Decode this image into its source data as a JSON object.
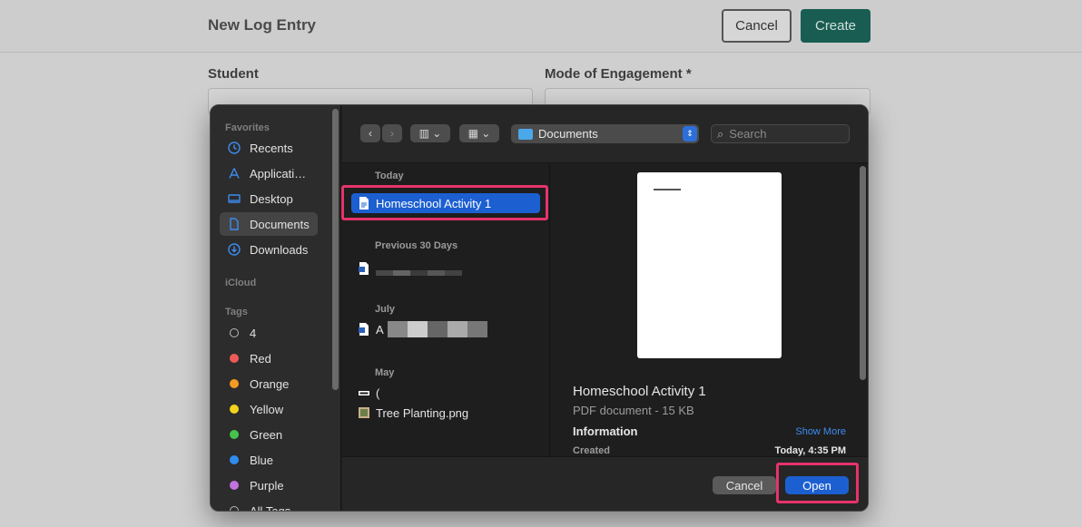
{
  "background_page": {
    "title": "New Log Entry",
    "cancel_label": "Cancel",
    "create_label": "Create",
    "student_label": "Student",
    "student_value": "",
    "mode_label": "Mode of Engagement *",
    "mode_value": ""
  },
  "sidebar": {
    "favorites_heading": "Favorites",
    "favorites": [
      {
        "label": "Recents",
        "icon": "clock-icon"
      },
      {
        "label": "Applicati…",
        "icon": "applications-icon"
      },
      {
        "label": "Desktop",
        "icon": "desktop-icon"
      },
      {
        "label": "Documents",
        "icon": "document-icon",
        "active": true
      },
      {
        "label": "Downloads",
        "icon": "download-icon"
      }
    ],
    "icloud_heading": "iCloud",
    "tags_heading": "Tags",
    "tags": [
      {
        "label": "4",
        "color": "hollow"
      },
      {
        "label": "Red",
        "color": "#ee5b56"
      },
      {
        "label": "Orange",
        "color": "#f59a23"
      },
      {
        "label": "Yellow",
        "color": "#f3d21c"
      },
      {
        "label": "Green",
        "color": "#45c44b"
      },
      {
        "label": "Blue",
        "color": "#2f8cf0"
      },
      {
        "label": "Purple",
        "color": "#c173df"
      },
      {
        "label": "All Tags…",
        "color": "hollow"
      }
    ]
  },
  "toolbar": {
    "location": "Documents",
    "search_placeholder": "Search"
  },
  "file_list": {
    "today_heading": "Today",
    "selected_file": "Homeschool Activity 1",
    "previous30_heading": "Previous 30 Days",
    "july_heading": "July",
    "july_file_prefix": "A",
    "may_heading": "May",
    "may_file_1": "(",
    "may_file_2": "Tree Planting.png"
  },
  "preview": {
    "name": "Homeschool Activity 1",
    "meta": "PDF document - 15 KB",
    "information_label": "Information",
    "show_more": "Show More",
    "created_label": "Created",
    "created_value": "Today, 4:35 PM"
  },
  "footer": {
    "cancel_label": "Cancel",
    "open_label": "Open"
  }
}
